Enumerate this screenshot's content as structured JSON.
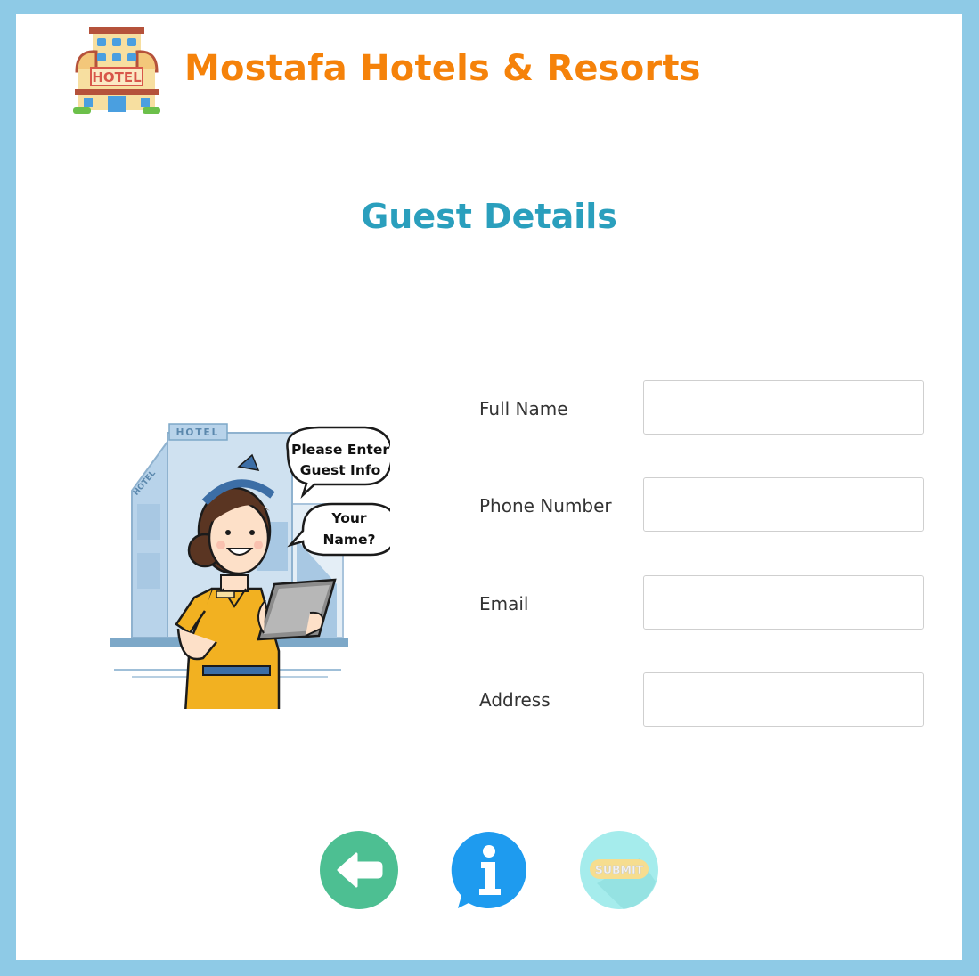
{
  "header": {
    "brand_name": "Mostafa Hotels & Resorts",
    "logo_icon": "hotel-building-icon",
    "logo_sign_text": "HOTEL"
  },
  "page": {
    "title": "Guest Details"
  },
  "illustration": {
    "building_sign": "HOTEL",
    "building_side_sign": "HOTEL",
    "bubble_1_line_1": "Please Enter",
    "bubble_1_line_2": "Guest Info",
    "bubble_2_line_1": "Your",
    "bubble_2_line_2": "Name?"
  },
  "form": {
    "full_name": {
      "label": "Full Name",
      "value": ""
    },
    "phone": {
      "label": "Phone Number",
      "value": ""
    },
    "email": {
      "label": "Email",
      "value": ""
    },
    "address": {
      "label": "Address",
      "value": ""
    }
  },
  "actions": {
    "back": {
      "icon": "arrow-left-icon",
      "color": "#4dbf92"
    },
    "info": {
      "icon": "info-icon",
      "color": "#1e9bef"
    },
    "submit": {
      "label": "SUBMIT",
      "color": "#a5ecec",
      "badge_color": "#f6dd8f"
    }
  },
  "colors": {
    "frame": "#8ecae6",
    "brand": "#f5820a",
    "title": "#2a9fbd"
  }
}
